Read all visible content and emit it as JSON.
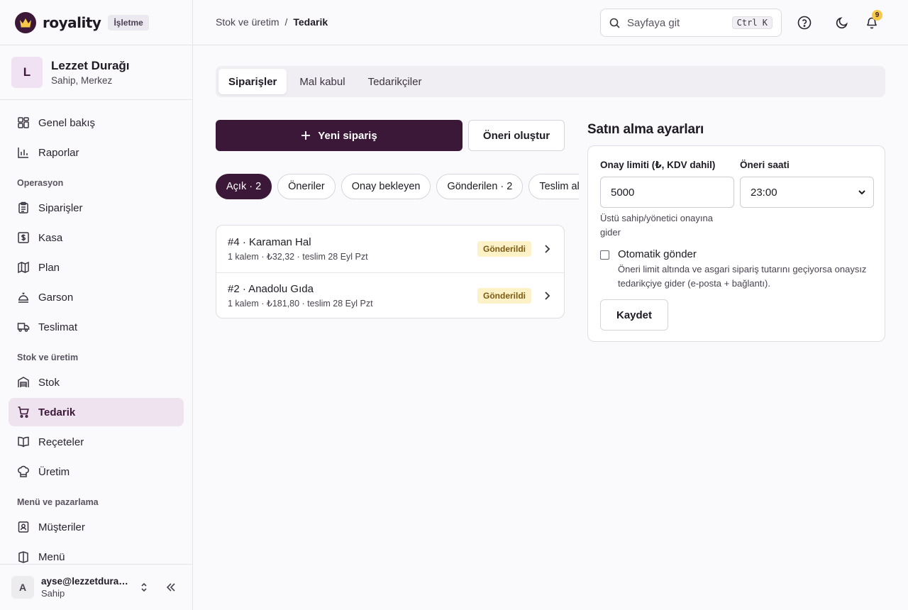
{
  "brand": {
    "name": "royality",
    "badge": "İşletme"
  },
  "org": {
    "initial": "L",
    "name": "Lezzet Durağı",
    "sub": "Sahip, Merkez"
  },
  "nav": {
    "top": [
      {
        "label": "Genel bakış",
        "icon": "dashboard-icon"
      },
      {
        "label": "Raporlar",
        "icon": "bar-chart-icon"
      }
    ],
    "groups": [
      {
        "title": "Operasyon",
        "items": [
          {
            "label": "Siparişler",
            "icon": "clipboard-icon"
          },
          {
            "label": "Kasa",
            "icon": "cash-register-icon"
          },
          {
            "label": "Plan",
            "icon": "map-icon"
          },
          {
            "label": "Garson",
            "icon": "waiter-icon"
          },
          {
            "label": "Teslimat",
            "icon": "truck-icon"
          }
        ]
      },
      {
        "title": "Stok ve üretim",
        "items": [
          {
            "label": "Stok",
            "icon": "warehouse-icon"
          },
          {
            "label": "Tedarik",
            "icon": "cart-icon",
            "active": true
          },
          {
            "label": "Reçeteler",
            "icon": "book-icon"
          },
          {
            "label": "Üretim",
            "icon": "chef-hat-icon"
          }
        ]
      },
      {
        "title": "Menü ve pazarlama",
        "items": [
          {
            "label": "Müşteriler",
            "icon": "contact-icon"
          },
          {
            "label": "Menü",
            "icon": "menu-icon"
          }
        ]
      }
    ]
  },
  "user": {
    "initial": "A",
    "email": "ayse@lezzetduragi.com",
    "role": "Sahip"
  },
  "header": {
    "crumbs": [
      "Stok ve üretim",
      "/",
      "Tedarik"
    ],
    "search_placeholder": "Sayfaya git",
    "shortcut": "Ctrl K",
    "notification_count": "9"
  },
  "tabs": [
    {
      "label": "Siparişler",
      "active": true
    },
    {
      "label": "Mal kabul"
    },
    {
      "label": "Tedarikçiler"
    }
  ],
  "actions": {
    "new_order": "Yeni sipariş",
    "create_suggestion": "Öneri oluştur"
  },
  "filters": [
    {
      "label": "Açık · 2",
      "active": true
    },
    {
      "label": "Öneriler"
    },
    {
      "label": "Onay bekleyen"
    },
    {
      "label": "Gönderilen · 2"
    },
    {
      "label": "Teslim alınan"
    }
  ],
  "orders": [
    {
      "title": "#4 · Karaman Hal",
      "sub": "1 kalem · ₺32,32 · teslim 28 Eyl Pzt",
      "status": "Gönderildi"
    },
    {
      "title": "#2 · Anadolu Gıda",
      "sub": "1 kalem · ₺181,80 · teslim 28 Eyl Pzt",
      "status": "Gönderildi"
    }
  ],
  "settings": {
    "title": "Satın alma ayarları",
    "limit_label": "Onay limiti (₺, KDV dahil)",
    "limit_value": "5000",
    "limit_hint": "Üstü sahip/yönetici onayına gider",
    "time_label": "Öneri saati",
    "time_value": "23:00",
    "auto_label": "Otomatik gönder",
    "auto_hint": "Öneri limit altında ve asgari sipariş tutarını geçiyorsa onaysız tedarikçiye gider (e-posta + bağlantı).",
    "save_label": "Kaydet"
  },
  "colors": {
    "accent": "#3b1838",
    "active_bg": "#efe3f0",
    "badge_bg": "#fdf1c8",
    "notif": "#f7c948"
  }
}
